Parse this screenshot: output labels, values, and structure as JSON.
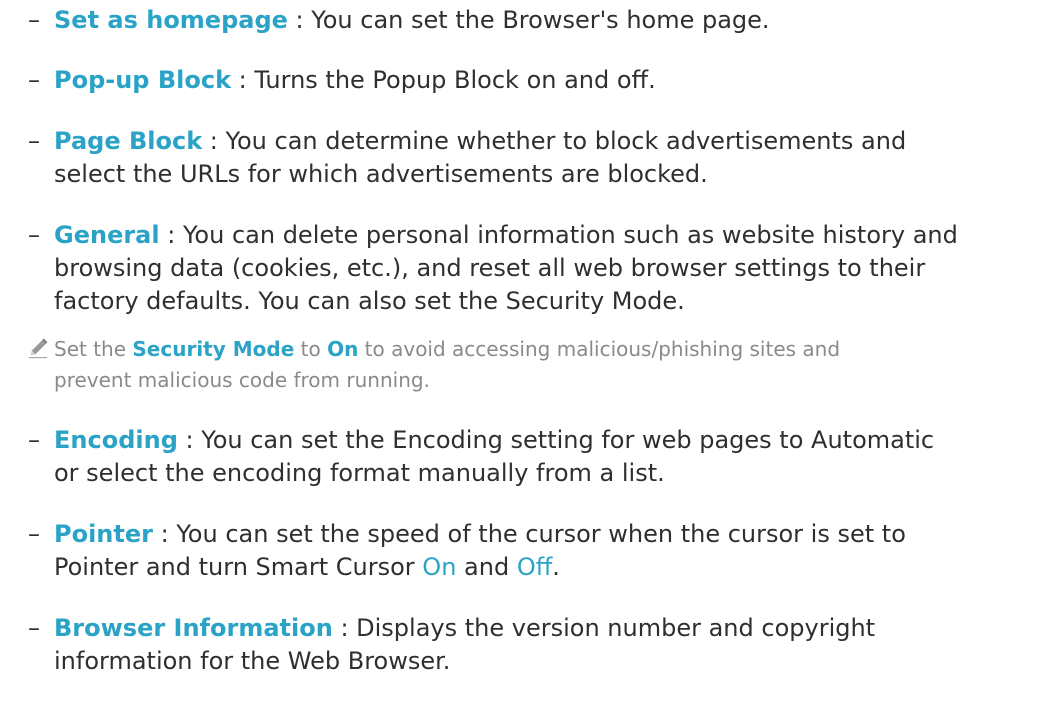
{
  "items": [
    {
      "term": "Set as homepage",
      "separator": " : ",
      "text": "You can set the Browser's home page."
    },
    {
      "term": "Pop-up Block",
      "separator": " : ",
      "text": "Turns the Popup Block on and off."
    },
    {
      "term": "Page Block",
      "separator": " : ",
      "text_line1": "You can determine whether to block advertisements and",
      "text_line2": "select the URLs for which advertisements are blocked."
    },
    {
      "term": "General",
      "separator": " : ",
      "text_line1": "You can delete personal information such as website history and",
      "text_line2": "browsing data (cookies, etc.), and reset all web browser settings to their",
      "text_line3": "factory defaults. You can also set the Security Mode."
    },
    {
      "term": "Encoding",
      "separator": " : ",
      "text_line1": "You can set the Encoding setting for web pages to Automatic",
      "text_line2": "or select the encoding format manually from a list."
    },
    {
      "term": "Pointer",
      "separator": " : ",
      "text_line1": "You can set the speed of the cursor when the cursor is set to",
      "text_line2_a": "Pointer and turn Smart Cursor ",
      "text_line2_on": "On",
      "text_line2_b": " and ",
      "text_line2_off": "Off",
      "text_line2_c": "."
    },
    {
      "term": "Browser Information",
      "separator": " : ",
      "text_line1": "Displays the version number and copyright",
      "text_line2": "information for the Web Browser."
    }
  ],
  "note": {
    "icon": "pencil-icon",
    "part1": "Set the ",
    "security_mode": "Security Mode",
    "part2": " to ",
    "on": "On",
    "part3": " to avoid accessing malicious/phishing sites and",
    "line2": "prevent malicious code from running."
  },
  "dash": "–",
  "colors": {
    "accent": "#2aa3c6",
    "text": "#2f2f2f",
    "note": "#8a8a8a"
  }
}
